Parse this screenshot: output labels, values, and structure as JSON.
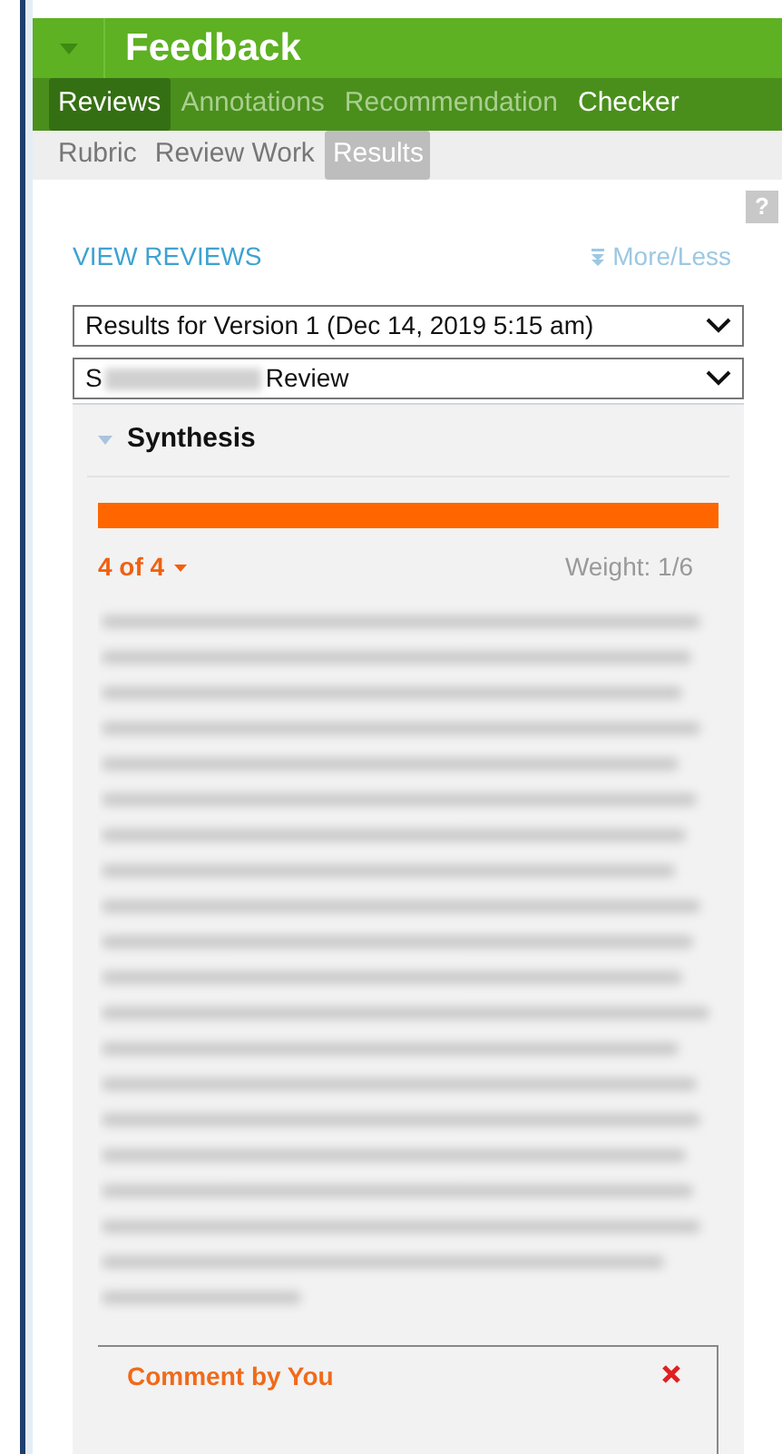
{
  "panel": {
    "title": "Feedback",
    "expanded": true
  },
  "tabs": [
    {
      "label": "Reviews",
      "selected": true
    },
    {
      "label": "Annotations",
      "selected": false
    },
    {
      "label": "Recommendation",
      "selected": false
    },
    {
      "label": "Checker",
      "selected": false
    }
  ],
  "subtabs": [
    {
      "label": "Rubric",
      "selected": false
    },
    {
      "label": "Review Work",
      "selected": false
    },
    {
      "label": "Results",
      "selected": true
    }
  ],
  "help": "?",
  "view_reviews": "VIEW REVIEWS",
  "more_less": "More/Less",
  "version_select": "Results for Version 1 (Dec 14, 2019 5:15 am)",
  "reviewer_select": {
    "prefix": "S",
    "suffix": "Review"
  },
  "criterion": {
    "title": "Synthesis",
    "expanded": true,
    "score": "4 of 4",
    "weight": "Weight: 1/6"
  },
  "comment": {
    "title": "Comment by You"
  }
}
